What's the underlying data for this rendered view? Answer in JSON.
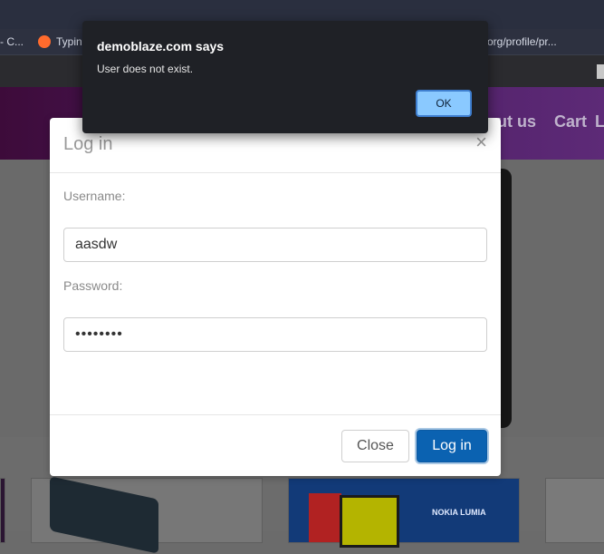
{
  "browser": {
    "bookmarks": [
      "- C...",
      "Typin",
      "org/profile/pr..."
    ]
  },
  "site": {
    "nav": [
      "out us",
      "Cart",
      "Lo"
    ]
  },
  "carousel_card": {
    "brand": "NOKIA LUMIA"
  },
  "modal": {
    "title": "Log in",
    "close_symbol": "×",
    "username_label": "Username:",
    "username_value": "aasdw",
    "password_label": "Password:",
    "password_value": "••••••••",
    "close_button": "Close",
    "login_button": "Log in"
  },
  "alert": {
    "title": "demoblaze.com says",
    "message": "User does not exist.",
    "ok_button": "OK"
  }
}
